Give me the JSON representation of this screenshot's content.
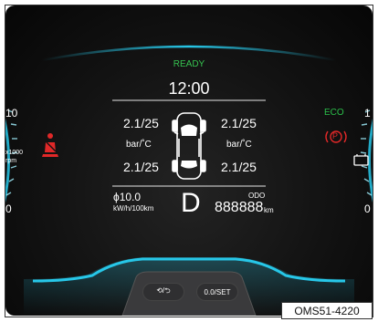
{
  "status": {
    "ready": "READY",
    "clock": "12:00"
  },
  "tires": {
    "front_left": "2.1/25",
    "front_right": "2.1/25",
    "unit_left": "bar/˚C",
    "unit_right": "bar/˚C",
    "rear_left": "2.1/25",
    "rear_right": "2.1/25"
  },
  "left_gauge": {
    "top": "10",
    "mid_line1": "x1000",
    "mid_line2": "rpm",
    "bottom": "0"
  },
  "right_gauge": {
    "top": "1",
    "bottom": "0"
  },
  "indicators": {
    "eco": "ECO",
    "parking": "P"
  },
  "consumption": {
    "value": "ϕ10.0",
    "unit": "kW/h/100km"
  },
  "gear": "D",
  "odometer": {
    "label": "ODO",
    "value": "888888",
    "unit": "km"
  },
  "buttons": {
    "mode_label": "⟲/⮌",
    "set_label": "0.0/SET"
  },
  "figure_code": "OMS51-4220",
  "colors": {
    "accent_cyan": "#27c7e8",
    "ready_green": "#36c24f",
    "warning_red": "#e02828",
    "eco_green": "#2bc04a"
  },
  "icons": {
    "seatbelt": "seatbelt-warning-icon",
    "car": "car-top-view-icon",
    "parking": "parking-brake-icon",
    "battery": "battery-icon"
  }
}
